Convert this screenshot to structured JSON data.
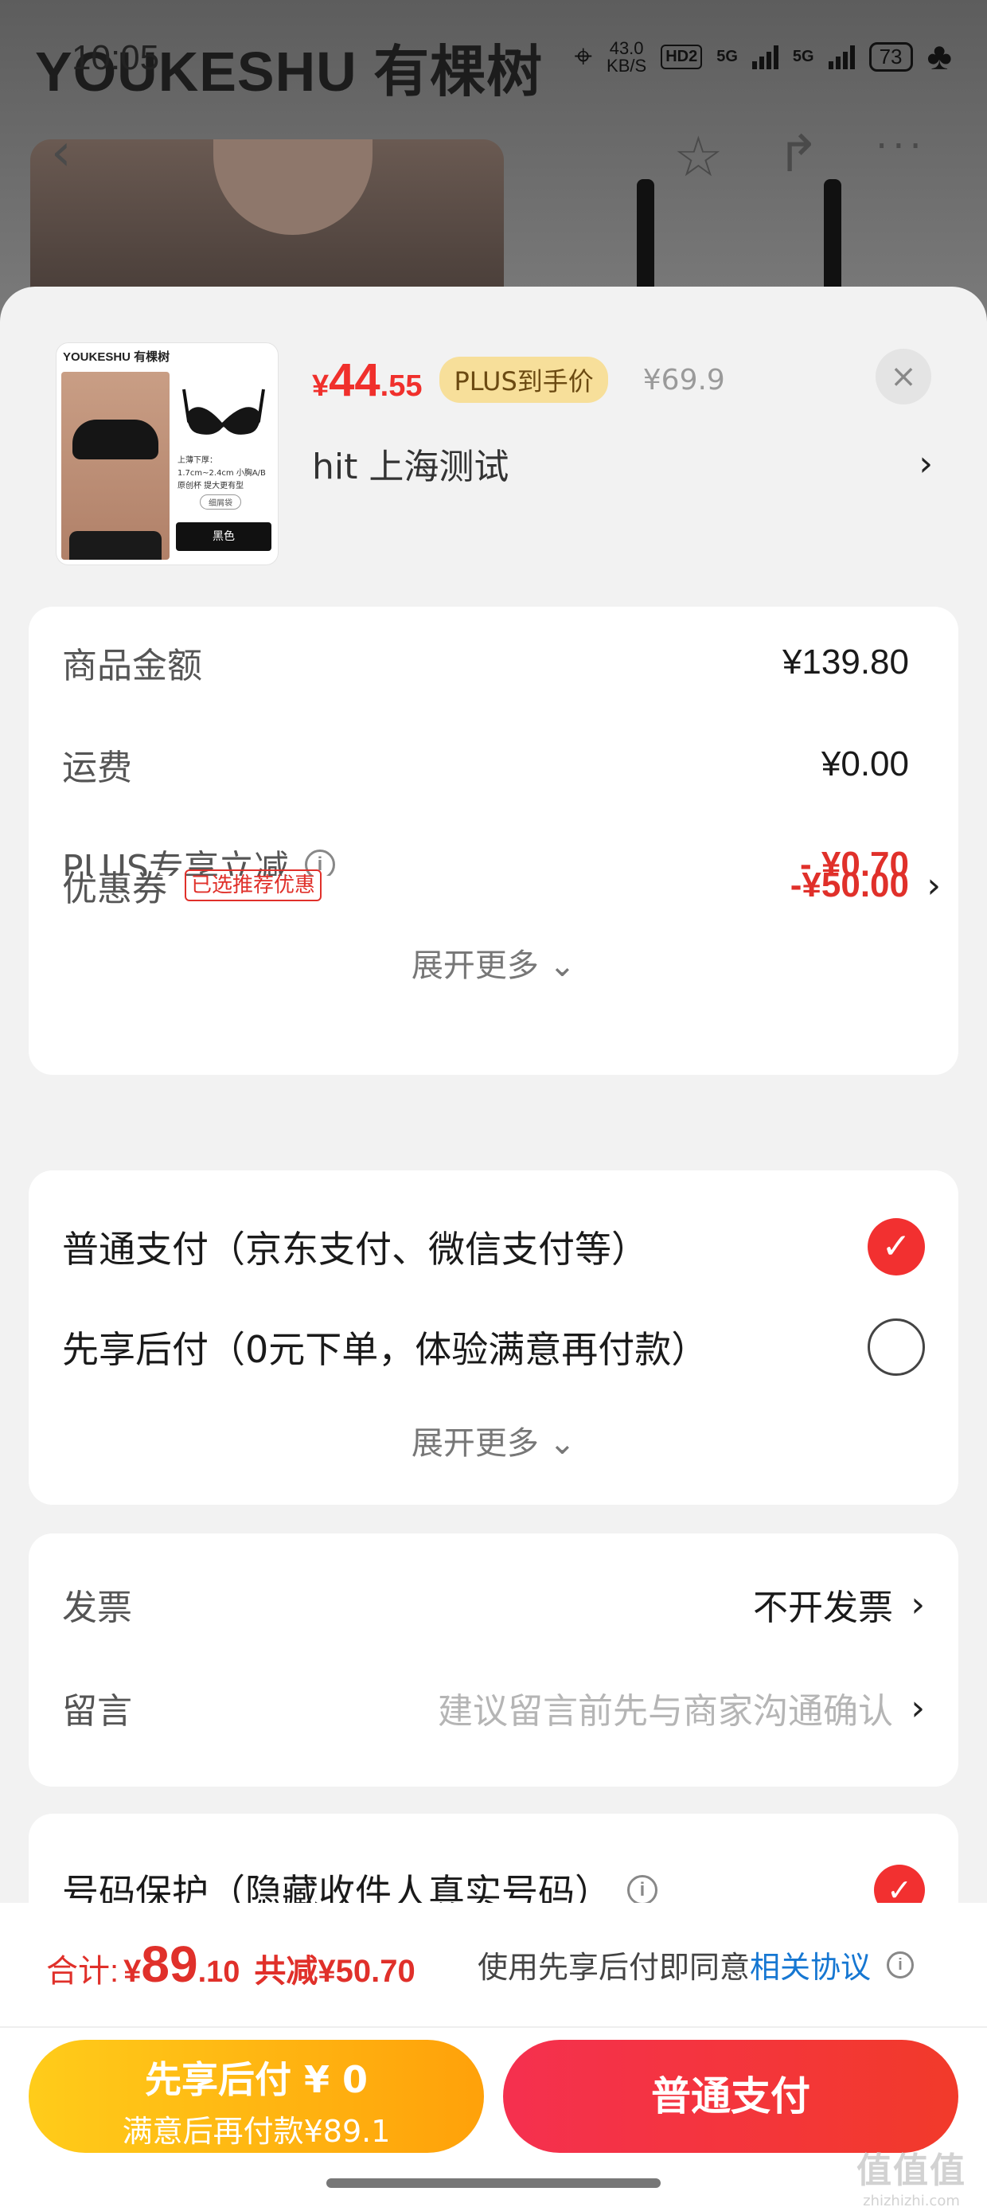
{
  "background": {
    "brand": "YOUKESHU 有棵树",
    "time": "10:05"
  },
  "status_bar": {
    "speed_value": "43.0",
    "speed_unit": "KB/S",
    "hd": "HD2",
    "signal1": "5G",
    "signal2": "5G",
    "battery": "73"
  },
  "product": {
    "thumb_brand": "YOUKESHU 有棵树",
    "thumb_desc": "上薄下厚：1.7cm~2.4cm 小胸A/B原创杯 提大更有型",
    "thumb_pill": "细屑袋",
    "thumb_color": "黑色",
    "price_symbol": "¥",
    "price_int": "44",
    "price_dec": ".55",
    "plus_tag": "PLUS到手价",
    "original_price": "¥69.9",
    "spec": "hit  上海测试",
    "close": "×"
  },
  "summary": {
    "rows": [
      {
        "label": "商品金额",
        "value": "¥139.80"
      },
      {
        "label": "运费",
        "value": "¥0.00"
      },
      {
        "label": "PLUS专享立减",
        "value": "- ¥0.70"
      },
      {
        "label": "优惠券",
        "value": "-¥50.00",
        "badge": "已选推荐优惠"
      }
    ],
    "expand": "展开更多"
  },
  "payment": {
    "options": [
      {
        "label": "普通支付（京东支付、微信支付等）",
        "selected": true
      },
      {
        "label": "先享后付（0元下单，体验满意再付款）",
        "selected": false
      }
    ],
    "expand": "展开更多"
  },
  "extras": {
    "invoice_label": "发票",
    "invoice_value": "不开发票",
    "note_label": "留言",
    "note_placeholder": "建议留言前先与商家沟通确认"
  },
  "privacy": {
    "label": "号码保护（隐藏收件人真实号码）"
  },
  "footer": {
    "total_label": "合计:",
    "total_symbol": "¥",
    "total_int": "89",
    "total_dec": ".10",
    "saved": "共减¥50.70",
    "agree_text": "使用先享后付即同意",
    "agree_link": "相关协议",
    "btn_later_line1": "先享后付 ¥ 0",
    "btn_later_line2": "满意后再付款¥89.1",
    "btn_pay": "普通支付"
  },
  "watermark": {
    "line1": "值值值",
    "line2": "zhizhizhi.com"
  },
  "colors": {
    "accent_red": "#f23030",
    "plus_gold": "#f7df9a",
    "later_orange": "#ffa10a",
    "link_blue": "#1677d2"
  }
}
